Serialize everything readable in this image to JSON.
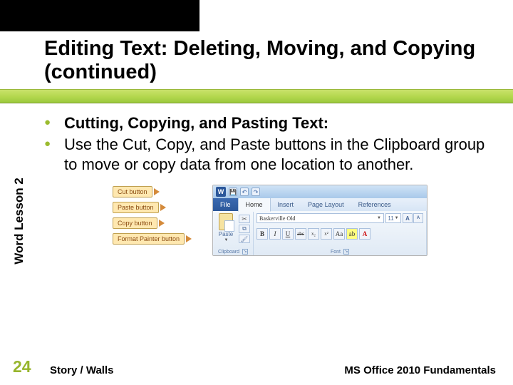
{
  "header": {
    "title": "Editing Text: Deleting, Moving, and Copying (continued)"
  },
  "sidebar": {
    "label": "Word Lesson 2"
  },
  "bullets": {
    "items": [
      {
        "text": "Cutting, Copying, and Pasting Text:",
        "bold": true
      },
      {
        "text": "Use the Cut, Copy, and Paste buttons in the Clipboard group to move or copy data from one location to another.",
        "bold": false
      }
    ]
  },
  "callouts": {
    "cut": "Cut button",
    "paste": "Paste button",
    "copy": "Copy button",
    "fp": "Format Painter button"
  },
  "ribbon": {
    "w": "W",
    "tabs": {
      "file": "File",
      "home": "Home",
      "insert": "Insert",
      "pagelayout": "Page Layout",
      "references": "References"
    },
    "clipboard": {
      "paste_label": "Paste",
      "group_label": "Clipboard"
    },
    "font": {
      "name": "Baskerville Old",
      "size": "11",
      "group_label": "Font",
      "b": "B",
      "i": "I",
      "u": "U",
      "abc": "abc",
      "x2": "x₂",
      "x2u": "x²",
      "A_big": "A",
      "A_sml": "A",
      "Aa": "Aa",
      "Ahl": "ab",
      "Afc": "A"
    }
  },
  "footer": {
    "page": "24",
    "author": "Story / Walls",
    "book": "MS Office 2010 Fundamentals"
  },
  "colors": {
    "accent": "#97b52c"
  }
}
